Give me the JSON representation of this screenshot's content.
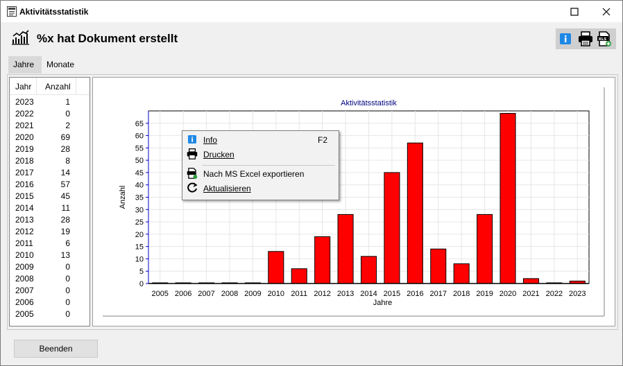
{
  "window": {
    "title": "Aktivitätsstatistik"
  },
  "header": {
    "title": "%x hat Dokument erstellt"
  },
  "toolbar": {
    "info_icon": "info-icon",
    "print_icon": "printer-icon",
    "excel_icon": "excel-export-icon"
  },
  "tabs": [
    {
      "label": "Jahre",
      "active": true
    },
    {
      "label": "Monate",
      "active": false
    }
  ],
  "list": {
    "col_year": "Jahr",
    "col_count": "Anzahl",
    "rows": [
      {
        "year": "2023",
        "count": "1"
      },
      {
        "year": "2022",
        "count": "0"
      },
      {
        "year": "2021",
        "count": "2"
      },
      {
        "year": "2020",
        "count": "69"
      },
      {
        "year": "2019",
        "count": "28"
      },
      {
        "year": "2018",
        "count": "8"
      },
      {
        "year": "2017",
        "count": "14"
      },
      {
        "year": "2016",
        "count": "57"
      },
      {
        "year": "2015",
        "count": "45"
      },
      {
        "year": "2014",
        "count": "11"
      },
      {
        "year": "2013",
        "count": "28"
      },
      {
        "year": "2012",
        "count": "19"
      },
      {
        "year": "2011",
        "count": "6"
      },
      {
        "year": "2010",
        "count": "13"
      },
      {
        "year": "2009",
        "count": "0"
      },
      {
        "year": "2008",
        "count": "0"
      },
      {
        "year": "2007",
        "count": "0"
      },
      {
        "year": "2006",
        "count": "0"
      },
      {
        "year": "2005",
        "count": "0"
      }
    ]
  },
  "chart_data": {
    "type": "bar",
    "title": "Aktivitätsstatistik",
    "xlabel": "Jahre",
    "ylabel": "Anzahl",
    "categories": [
      "2005",
      "2006",
      "2007",
      "2008",
      "2009",
      "2010",
      "2011",
      "2012",
      "2013",
      "2014",
      "2015",
      "2016",
      "2017",
      "2018",
      "2019",
      "2020",
      "2021",
      "2022",
      "2023"
    ],
    "values": [
      0,
      0,
      0,
      0,
      0,
      13,
      6,
      19,
      28,
      11,
      45,
      57,
      14,
      8,
      28,
      69,
      2,
      0,
      1
    ],
    "ylim": [
      0,
      70
    ],
    "yticks": [
      0,
      5,
      10,
      15,
      20,
      25,
      30,
      35,
      40,
      45,
      50,
      55,
      60,
      65
    ],
    "grid": true,
    "bar_color": "#ff0000",
    "title_color": "#000080"
  },
  "context_menu": {
    "items": [
      {
        "label": "Info",
        "shortcut": "F2",
        "icon": "info-icon"
      },
      {
        "label": "Drucken",
        "shortcut": "",
        "icon": "printer-icon"
      },
      {
        "label": "Nach MS Excel exportieren",
        "shortcut": "",
        "icon": "excel-export-icon"
      },
      {
        "label": "Aktualisieren",
        "shortcut": "",
        "icon": "refresh-icon"
      }
    ]
  },
  "footer": {
    "close_label": "Beenden"
  }
}
